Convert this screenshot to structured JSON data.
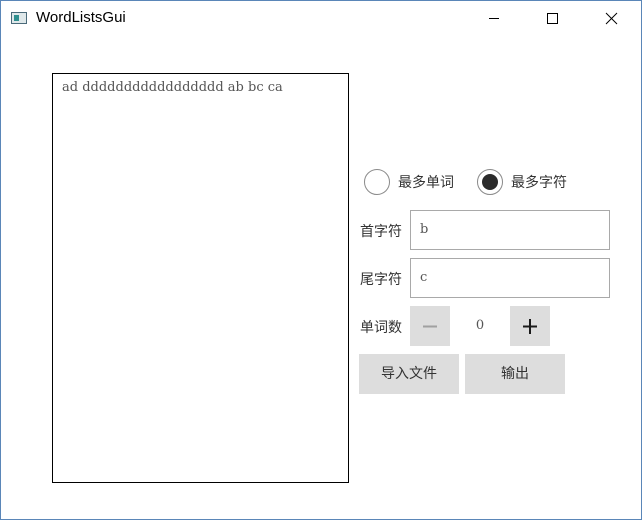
{
  "window": {
    "title": "WordListsGui",
    "icon": "app-window-icon",
    "controls": [
      "minimize-icon",
      "maximize-icon",
      "close-icon"
    ],
    "border_color": "#5a86b8"
  },
  "text_area": {
    "content": "ad ddddddddddddddddd ab bc ca"
  },
  "mode": {
    "options": [
      {
        "label": "最多单词",
        "checked": false
      },
      {
        "label": "最多字符",
        "checked": true
      }
    ]
  },
  "fields": {
    "first_char": {
      "label": "首字符",
      "value": "b"
    },
    "last_char": {
      "label": "尾字符",
      "value": "c"
    }
  },
  "word_count": {
    "label": "单词数",
    "value": "0",
    "minus_icon": "minus-icon",
    "plus_icon": "plus-icon"
  },
  "actions": {
    "import_label": "导入文件",
    "export_label": "输出"
  },
  "colors": {
    "button_bg": "#dddddd",
    "radio_fill": "#2b2b2b"
  }
}
